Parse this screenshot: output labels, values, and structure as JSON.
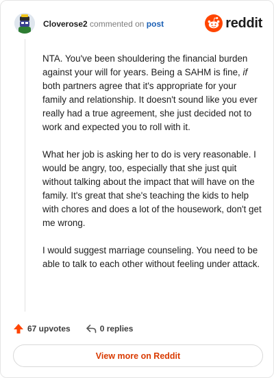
{
  "header": {
    "username": "Cloverose2",
    "action_text": "commented on",
    "post_link": "post",
    "brand": "reddit"
  },
  "comment": {
    "paragraph_1_a": "NTA. You've been shouldering the financial burden against your will for years. Being a SAHM is fine, ",
    "paragraph_1_em": "if",
    "paragraph_1_b": " both partners agree that it's appropriate for your family and relationship. It doesn't sound like you ever really had a true agreement, she just decided not to work and expected you to roll with it.",
    "paragraph_2": "What her job is asking her to do is very reasonable. I would be angry, too, especially that she just quit without talking about the impact that will have on the family. It's great that she's teaching the kids to help with chores and does a lot of the housework, don't get me wrong.",
    "paragraph_3": "I would suggest marriage counseling. You need to be able to talk to each other without feeling under attack."
  },
  "footer": {
    "upvotes": "67 upvotes",
    "replies": "0 replies",
    "view_more": "View more on Reddit"
  },
  "colors": {
    "accent_orange": "#ff4500",
    "upvote": "#ff4500",
    "link_blue": "#1a5fb4",
    "view_more_text": "#d93a00"
  },
  "icons": {
    "brand": "reddit-logo-icon",
    "upvote": "upvote-arrow-icon",
    "reply": "reply-arrow-icon"
  }
}
